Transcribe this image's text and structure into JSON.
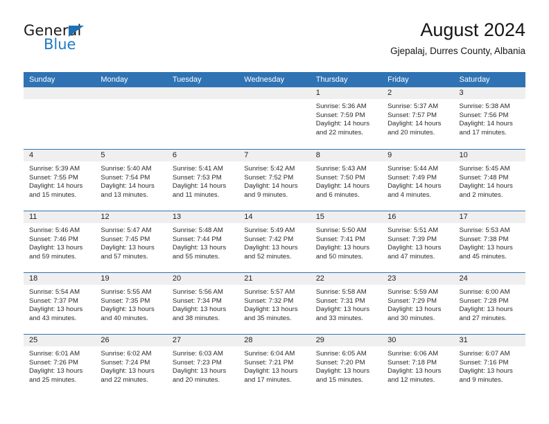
{
  "logo": {
    "word_top": "General",
    "word_bottom": "Blue",
    "triangle_color": "#1f6fb5",
    "blue_color": "#1f7bc1"
  },
  "header": {
    "title": "August 2024",
    "subtitle": "Gjepalaj, Durres County, Albania"
  },
  "theme": {
    "header_blue": "#2f73b4",
    "day_band_gray": "#efefef",
    "text_color": "#222222"
  },
  "calendar": {
    "weekdays": [
      "Sunday",
      "Monday",
      "Tuesday",
      "Wednesday",
      "Thursday",
      "Friday",
      "Saturday"
    ],
    "weeks": [
      [
        {
          "day": "",
          "empty": true
        },
        {
          "day": "",
          "empty": true
        },
        {
          "day": "",
          "empty": true
        },
        {
          "day": "",
          "empty": true
        },
        {
          "day": "1",
          "sunrise": "Sunrise: 5:36 AM",
          "sunset": "Sunset: 7:59 PM",
          "daylight_line1": "Daylight: 14 hours",
          "daylight_line2": "and 22 minutes."
        },
        {
          "day": "2",
          "sunrise": "Sunrise: 5:37 AM",
          "sunset": "Sunset: 7:57 PM",
          "daylight_line1": "Daylight: 14 hours",
          "daylight_line2": "and 20 minutes."
        },
        {
          "day": "3",
          "sunrise": "Sunrise: 5:38 AM",
          "sunset": "Sunset: 7:56 PM",
          "daylight_line1": "Daylight: 14 hours",
          "daylight_line2": "and 17 minutes."
        }
      ],
      [
        {
          "day": "4",
          "sunrise": "Sunrise: 5:39 AM",
          "sunset": "Sunset: 7:55 PM",
          "daylight_line1": "Daylight: 14 hours",
          "daylight_line2": "and 15 minutes."
        },
        {
          "day": "5",
          "sunrise": "Sunrise: 5:40 AM",
          "sunset": "Sunset: 7:54 PM",
          "daylight_line1": "Daylight: 14 hours",
          "daylight_line2": "and 13 minutes."
        },
        {
          "day": "6",
          "sunrise": "Sunrise: 5:41 AM",
          "sunset": "Sunset: 7:53 PM",
          "daylight_line1": "Daylight: 14 hours",
          "daylight_line2": "and 11 minutes."
        },
        {
          "day": "7",
          "sunrise": "Sunrise: 5:42 AM",
          "sunset": "Sunset: 7:52 PM",
          "daylight_line1": "Daylight: 14 hours",
          "daylight_line2": "and 9 minutes."
        },
        {
          "day": "8",
          "sunrise": "Sunrise: 5:43 AM",
          "sunset": "Sunset: 7:50 PM",
          "daylight_line1": "Daylight: 14 hours",
          "daylight_line2": "and 6 minutes."
        },
        {
          "day": "9",
          "sunrise": "Sunrise: 5:44 AM",
          "sunset": "Sunset: 7:49 PM",
          "daylight_line1": "Daylight: 14 hours",
          "daylight_line2": "and 4 minutes."
        },
        {
          "day": "10",
          "sunrise": "Sunrise: 5:45 AM",
          "sunset": "Sunset: 7:48 PM",
          "daylight_line1": "Daylight: 14 hours",
          "daylight_line2": "and 2 minutes."
        }
      ],
      [
        {
          "day": "11",
          "sunrise": "Sunrise: 5:46 AM",
          "sunset": "Sunset: 7:46 PM",
          "daylight_line1": "Daylight: 13 hours",
          "daylight_line2": "and 59 minutes."
        },
        {
          "day": "12",
          "sunrise": "Sunrise: 5:47 AM",
          "sunset": "Sunset: 7:45 PM",
          "daylight_line1": "Daylight: 13 hours",
          "daylight_line2": "and 57 minutes."
        },
        {
          "day": "13",
          "sunrise": "Sunrise: 5:48 AM",
          "sunset": "Sunset: 7:44 PM",
          "daylight_line1": "Daylight: 13 hours",
          "daylight_line2": "and 55 minutes."
        },
        {
          "day": "14",
          "sunrise": "Sunrise: 5:49 AM",
          "sunset": "Sunset: 7:42 PM",
          "daylight_line1": "Daylight: 13 hours",
          "daylight_line2": "and 52 minutes."
        },
        {
          "day": "15",
          "sunrise": "Sunrise: 5:50 AM",
          "sunset": "Sunset: 7:41 PM",
          "daylight_line1": "Daylight: 13 hours",
          "daylight_line2": "and 50 minutes."
        },
        {
          "day": "16",
          "sunrise": "Sunrise: 5:51 AM",
          "sunset": "Sunset: 7:39 PM",
          "daylight_line1": "Daylight: 13 hours",
          "daylight_line2": "and 47 minutes."
        },
        {
          "day": "17",
          "sunrise": "Sunrise: 5:53 AM",
          "sunset": "Sunset: 7:38 PM",
          "daylight_line1": "Daylight: 13 hours",
          "daylight_line2": "and 45 minutes."
        }
      ],
      [
        {
          "day": "18",
          "sunrise": "Sunrise: 5:54 AM",
          "sunset": "Sunset: 7:37 PM",
          "daylight_line1": "Daylight: 13 hours",
          "daylight_line2": "and 43 minutes."
        },
        {
          "day": "19",
          "sunrise": "Sunrise: 5:55 AM",
          "sunset": "Sunset: 7:35 PM",
          "daylight_line1": "Daylight: 13 hours",
          "daylight_line2": "and 40 minutes."
        },
        {
          "day": "20",
          "sunrise": "Sunrise: 5:56 AM",
          "sunset": "Sunset: 7:34 PM",
          "daylight_line1": "Daylight: 13 hours",
          "daylight_line2": "and 38 minutes."
        },
        {
          "day": "21",
          "sunrise": "Sunrise: 5:57 AM",
          "sunset": "Sunset: 7:32 PM",
          "daylight_line1": "Daylight: 13 hours",
          "daylight_line2": "and 35 minutes."
        },
        {
          "day": "22",
          "sunrise": "Sunrise: 5:58 AM",
          "sunset": "Sunset: 7:31 PM",
          "daylight_line1": "Daylight: 13 hours",
          "daylight_line2": "and 33 minutes."
        },
        {
          "day": "23",
          "sunrise": "Sunrise: 5:59 AM",
          "sunset": "Sunset: 7:29 PM",
          "daylight_line1": "Daylight: 13 hours",
          "daylight_line2": "and 30 minutes."
        },
        {
          "day": "24",
          "sunrise": "Sunrise: 6:00 AM",
          "sunset": "Sunset: 7:28 PM",
          "daylight_line1": "Daylight: 13 hours",
          "daylight_line2": "and 27 minutes."
        }
      ],
      [
        {
          "day": "25",
          "sunrise": "Sunrise: 6:01 AM",
          "sunset": "Sunset: 7:26 PM",
          "daylight_line1": "Daylight: 13 hours",
          "daylight_line2": "and 25 minutes."
        },
        {
          "day": "26",
          "sunrise": "Sunrise: 6:02 AM",
          "sunset": "Sunset: 7:24 PM",
          "daylight_line1": "Daylight: 13 hours",
          "daylight_line2": "and 22 minutes."
        },
        {
          "day": "27",
          "sunrise": "Sunrise: 6:03 AM",
          "sunset": "Sunset: 7:23 PM",
          "daylight_line1": "Daylight: 13 hours",
          "daylight_line2": "and 20 minutes."
        },
        {
          "day": "28",
          "sunrise": "Sunrise: 6:04 AM",
          "sunset": "Sunset: 7:21 PM",
          "daylight_line1": "Daylight: 13 hours",
          "daylight_line2": "and 17 minutes."
        },
        {
          "day": "29",
          "sunrise": "Sunrise: 6:05 AM",
          "sunset": "Sunset: 7:20 PM",
          "daylight_line1": "Daylight: 13 hours",
          "daylight_line2": "and 15 minutes."
        },
        {
          "day": "30",
          "sunrise": "Sunrise: 6:06 AM",
          "sunset": "Sunset: 7:18 PM",
          "daylight_line1": "Daylight: 13 hours",
          "daylight_line2": "and 12 minutes."
        },
        {
          "day": "31",
          "sunrise": "Sunrise: 6:07 AM",
          "sunset": "Sunset: 7:16 PM",
          "daylight_line1": "Daylight: 13 hours",
          "daylight_line2": "and 9 minutes."
        }
      ]
    ]
  }
}
